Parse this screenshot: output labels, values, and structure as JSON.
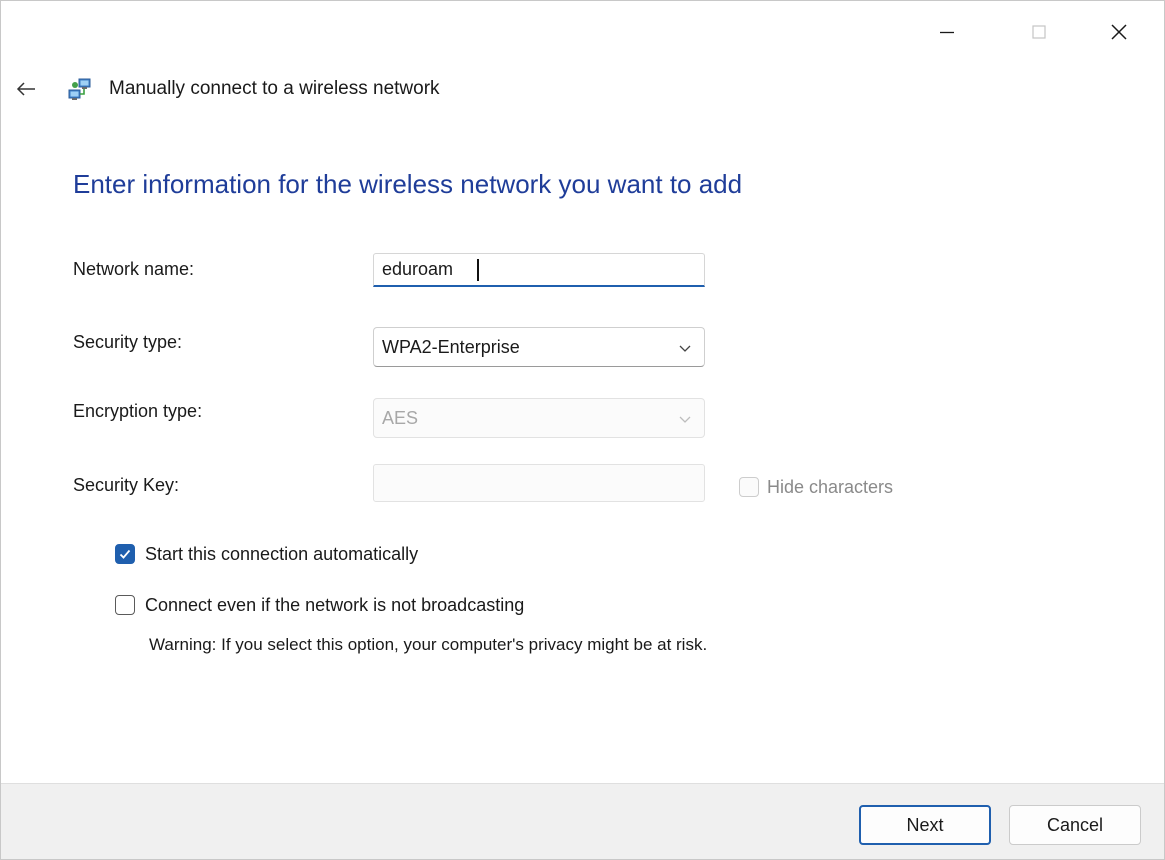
{
  "window": {
    "title": "Manually connect to a wireless network"
  },
  "main": {
    "heading": "Enter information for the wireless network you want to add"
  },
  "form": {
    "network_name": {
      "label": "Network name:",
      "value": "eduroam"
    },
    "security_type": {
      "label": "Security type:",
      "value": "WPA2-Enterprise"
    },
    "encryption_type": {
      "label": "Encryption type:",
      "value": "AES",
      "disabled": true
    },
    "security_key": {
      "label": "Security Key:",
      "value": "",
      "disabled": true
    },
    "hide_characters": {
      "label": "Hide characters",
      "checked": false,
      "disabled": true
    },
    "start_automatically": {
      "label": "Start this connection automatically",
      "checked": true
    },
    "connect_not_broadcasting": {
      "label": "Connect even if the network is not broadcasting",
      "checked": false
    },
    "warning": "Warning: If you select this option, your computer's privacy might be at risk."
  },
  "footer": {
    "next_label": "Next",
    "cancel_label": "Cancel"
  },
  "colors": {
    "heading": "#1f3d99",
    "accent": "#1f5fae",
    "footer_bg": "#f0f0f0"
  },
  "icons": {
    "minimize": "minimize-icon",
    "maximize": "maximize-icon",
    "close": "close-icon",
    "back": "back-arrow-icon",
    "network": "network-connection-icon",
    "dropdown": "chevron-down-icon",
    "check": "checkmark-icon"
  }
}
